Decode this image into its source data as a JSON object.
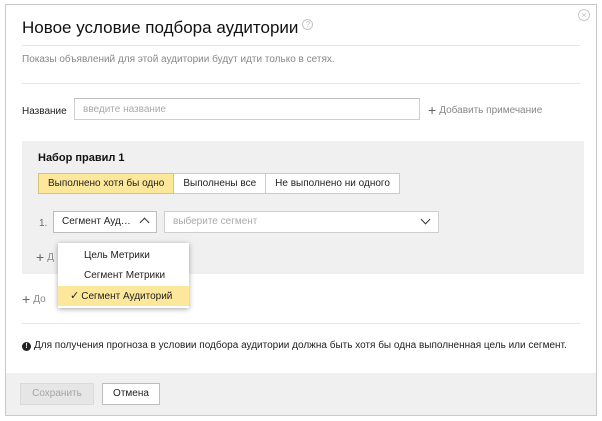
{
  "dialog": {
    "title": "Новое условие подбора аудитории",
    "subtitle": "Показы объявлений для этой аудитории будут идти только в сетях.",
    "name_label": "Название",
    "name_placeholder": "введите название",
    "name_value": "",
    "add_note_label": "Добавить примечание"
  },
  "ruleset": {
    "title": "Набор правил 1",
    "modes": [
      {
        "label": "Выполнено хотя бы одно",
        "active": true
      },
      {
        "label": "Выполнены все",
        "active": false
      },
      {
        "label": "Не выполнено ни одного",
        "active": false
      }
    ],
    "rule": {
      "number": "1.",
      "type_value": "Сегмент Ауд…",
      "segment_placeholder": "выберите сегмент"
    },
    "add_rule_label": "Д"
  },
  "dropdown": {
    "options": [
      {
        "label": "Цель Метрики",
        "selected": false
      },
      {
        "label": "Сегмент Метрики",
        "selected": false
      },
      {
        "label": "Сегмент Аудиторий",
        "selected": true
      }
    ],
    "check_glyph": "✓"
  },
  "add_set_label": "До",
  "info_text": "Для получения прогноза в условии подбора аудитории должна быть хотя бы одна выполненная цель или сегмент.",
  "footer": {
    "save_label": "Сохранить",
    "cancel_label": "Отмена"
  },
  "icons": {
    "help": "?",
    "close": "×",
    "plus": "+",
    "info": "!"
  },
  "colors": {
    "active_segment": "#fde79a",
    "panel_bg": "#f0f0f0"
  }
}
